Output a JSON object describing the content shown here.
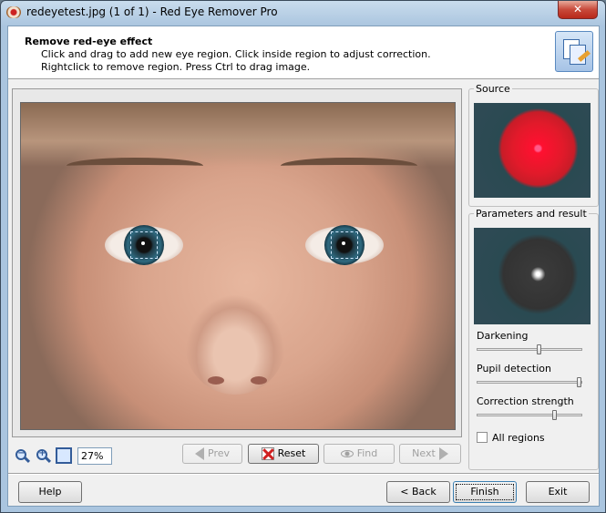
{
  "window": {
    "title": "redeyetest.jpg (1 of 1) - Red Eye Remover Pro",
    "close_glyph": "✕"
  },
  "header": {
    "title": "Remove red-eye effect",
    "line1": "Click and drag to add new eye region. Click inside region to adjust correction.",
    "line2": "Rightclick to remove region. Press Ctrl to drag image."
  },
  "toolbar": {
    "zoom_out_symbol": "−",
    "zoom_in_symbol": "+",
    "zoom_value": "27%",
    "prev_label": "Prev",
    "reset_label": "Reset",
    "find_label": "Find",
    "next_label": "Next"
  },
  "side": {
    "source_label": "Source",
    "params_label": "Parameters and result",
    "darkening_label": "Darkening",
    "darkening_value": 0.6,
    "pupil_label": "Pupil detection",
    "pupil_value": 1.0,
    "strength_label": "Correction strength",
    "strength_value": 0.75,
    "all_regions_label": "All regions",
    "all_regions_checked": false
  },
  "footer": {
    "help_label": "Help",
    "back_label": "< Back",
    "finish_label": "Finish",
    "exit_label": "Exit"
  }
}
